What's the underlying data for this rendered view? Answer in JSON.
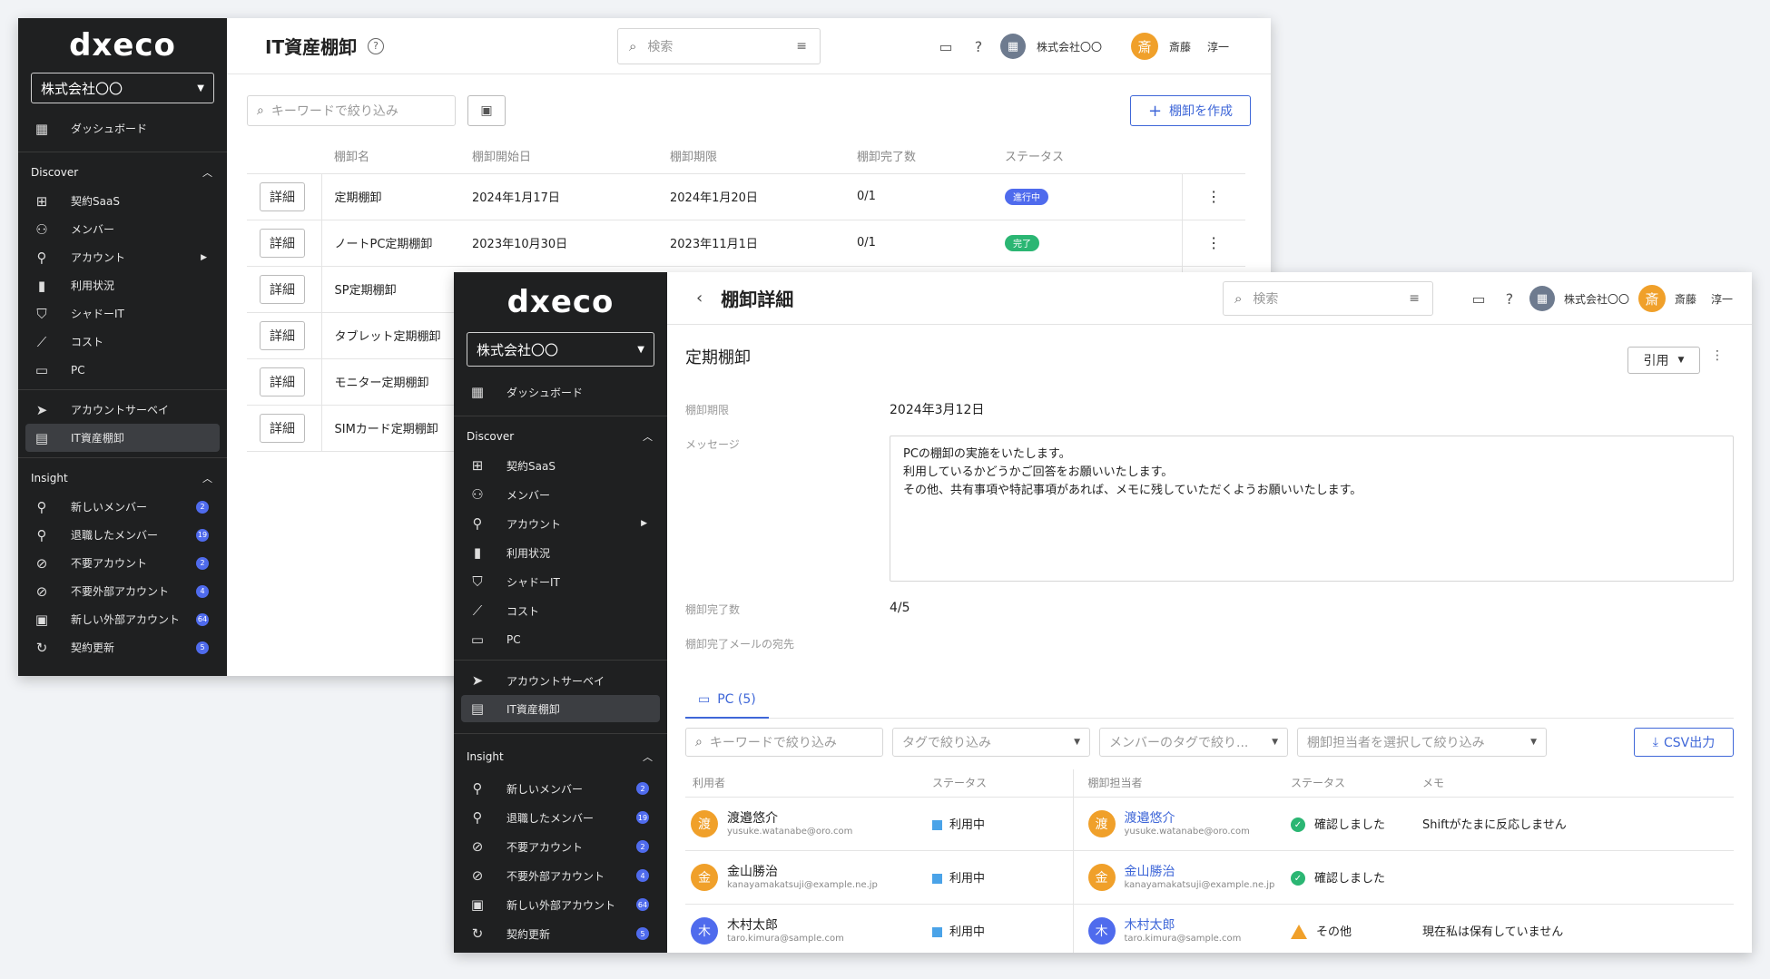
{
  "colors": {
    "sidebar_bg": "#1f2021",
    "accent": "#3f67d8",
    "in_progress": "#4f6bed",
    "done": "#2bb673",
    "badge": "#4f6bed",
    "avatar_orange": "#f0a02a",
    "avatar_blue": "#4f6bed"
  },
  "sidebar": {
    "logo": "dxeco",
    "company": "株式会社〇〇",
    "dashboard": "ダッシュボード",
    "discover_title": "Discover",
    "discover_items": [
      {
        "label": "契約SaaS",
        "icon": "apps-icon"
      },
      {
        "label": "メンバー",
        "icon": "people-icon"
      },
      {
        "label": "アカウント",
        "icon": "person-icon"
      },
      {
        "label": "利用状況",
        "icon": "bar-chart-icon"
      },
      {
        "label": "シャドーIT",
        "icon": "shield-icon"
      },
      {
        "label": "コスト",
        "icon": "trend-icon"
      },
      {
        "label": "PC",
        "icon": "devices-icon"
      }
    ],
    "survey": "アカウントサーベイ",
    "it_inventory": "IT資産棚卸",
    "insight_title": "Insight",
    "insight_items": [
      {
        "label": "新しいメンバー",
        "badge": "2",
        "icon": "person-add-icon"
      },
      {
        "label": "退職したメンバー",
        "badge": "19",
        "icon": "person-remove-icon"
      },
      {
        "label": "不要アカウント",
        "badge": "2",
        "icon": "person-off-icon"
      },
      {
        "label": "不要外部アカウント",
        "badge": "4",
        "icon": "person-off-icon"
      },
      {
        "label": "新しい外部アカウント",
        "badge": "64",
        "icon": "contact-icon"
      },
      {
        "label": "契約更新",
        "badge": "5",
        "icon": "renew-icon"
      }
    ]
  },
  "header": {
    "search_placeholder": "検索",
    "org_name": "株式会社〇〇",
    "user_initial": "斎",
    "user_last": "斎藤",
    "user_first": "淳一"
  },
  "list_page": {
    "title": "IT資産棚卸",
    "keyword_placeholder": "キーワードで絞り込み",
    "create_button": "棚卸を作成",
    "columns": [
      "棚卸名",
      "棚卸開始日",
      "棚卸期限",
      "棚卸完了数",
      "ステータス"
    ],
    "detail_label": "詳細",
    "rows": [
      {
        "name": "定期棚卸",
        "start": "2024年1月17日",
        "due": "2024年1月20日",
        "done": "0/1",
        "status": "進行中",
        "status_color": "#4f6bed"
      },
      {
        "name": "ノートPC定期棚卸",
        "start": "2023年10月30日",
        "due": "2023年11月1日",
        "done": "0/1",
        "status": "完了",
        "status_color": "#2bb673"
      },
      {
        "name": "SP定期棚卸"
      },
      {
        "name": "タブレット定期棚卸"
      },
      {
        "name": "モニター定期棚卸"
      },
      {
        "name": "SIMカード定期棚卸"
      }
    ]
  },
  "detail_page": {
    "title": "棚卸詳細",
    "heading": "定期棚卸",
    "quote_button": "引用",
    "due_label": "棚卸期限",
    "due_value": "2024年3月12日",
    "message_label": "メッセージ",
    "message_lines": [
      "PCの棚卸の実施をいたします。",
      "利用しているかどうかご回答をお願いいたします。",
      "その他、共有事項や特記事項があれば、メモに残していただくようお願いいたします。"
    ],
    "done_label": "棚卸完了数",
    "done_value": "4/5",
    "mail_label": "棚卸完了メールの宛先",
    "tab_label": "PC (5)",
    "filters": {
      "keyword": "キーワードで絞り込み",
      "tag": "タグで絞り込み",
      "member_tag": "メンバーのタグで絞り...",
      "assignee": "棚卸担当者を選択して絞り込み"
    },
    "csv_button": "CSV出力",
    "columns": [
      "利用者",
      "ステータス",
      "棚卸担当者",
      "ステータス",
      "メモ"
    ],
    "rows": [
      {
        "user": "渡邉悠介",
        "initial": "渡",
        "email": "yusuke.watanabe@oro.com",
        "use_status": "利用中",
        "assignee": "渡邉悠介",
        "a_email": "yusuke.watanabe@oro.com",
        "check": "確認しました",
        "memo": "Shiftがたまに反応しません",
        "color": "#f0a02a",
        "warn": false
      },
      {
        "user": "金山勝治",
        "initial": "金",
        "email": "kanayamakatsuji@example.ne.jp",
        "use_status": "利用中",
        "assignee": "金山勝治",
        "a_email": "kanayamakatsuji@example.ne.jp",
        "check": "確認しました",
        "memo": "",
        "color": "#f0a02a",
        "warn": false
      },
      {
        "user": "木村太郎",
        "initial": "木",
        "email": "taro.kimura@sample.com",
        "use_status": "利用中",
        "assignee": "木村太郎",
        "a_email": "taro.kimura@sample.com",
        "check": "その他",
        "memo": "現在私は保有していません",
        "color": "#4f6bed",
        "warn": true
      }
    ]
  }
}
